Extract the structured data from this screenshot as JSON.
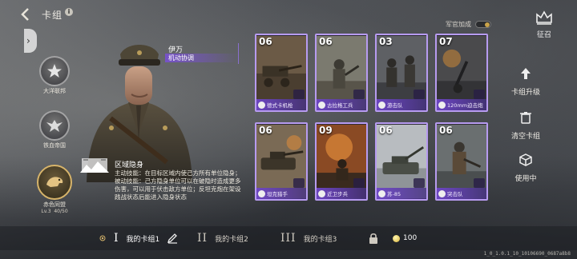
{
  "header": {
    "title": "卡组",
    "info_icon": "info-icon",
    "back_icon": "back-chevron-icon"
  },
  "bonus": {
    "label": "军官加成",
    "enabled": true
  },
  "recruit": {
    "label": "征召"
  },
  "factions": [
    {
      "name": "大洋联邦",
      "icon": "star-emblem-icon"
    },
    {
      "name": "铁血帝国",
      "icon": "eagle-emblem-icon"
    },
    {
      "name": "赤色同盟",
      "icon": "bear-emblem-icon",
      "active": true,
      "level": "Lv.3",
      "progress": "40/50"
    }
  ],
  "general": {
    "name": "伊万",
    "role": "机动协调",
    "skill_title": "区域隐身",
    "skill_active": "主动技能：在目标区域内使己方所有单位隐身；",
    "skill_passive": "被动技能：己方隐身单位可以在破隐时造成更多伤害，可以用于伏击敌方单位；反坦克炮在架设践战状态后能进入隐身状态"
  },
  "cards": [
    {
      "cost": "06",
      "name": "德式卡机枪"
    },
    {
      "cost": "06",
      "name": "古拉格工兵"
    },
    {
      "cost": "03",
      "name": "游击队"
    },
    {
      "cost": "07",
      "name": "120mm迫击炮"
    },
    {
      "cost": "06",
      "name": "坦克猎手"
    },
    {
      "cost": "09",
      "name": "近卫步兵"
    },
    {
      "cost": "06",
      "name": "苏-85"
    },
    {
      "cost": "06",
      "name": "突击队"
    }
  ],
  "actions": [
    {
      "label": "卡组升级",
      "icon": "upgrade-arrow-icon"
    },
    {
      "label": "清空卡组",
      "icon": "trash-icon"
    },
    {
      "label": "使用中",
      "icon": "cube-icon"
    }
  ],
  "decks": [
    {
      "roman": "I",
      "label": "我的卡组1",
      "active": true
    },
    {
      "roman": "II",
      "label": "我的卡组2"
    },
    {
      "roman": "III",
      "label": "我的卡组3"
    }
  ],
  "currency": {
    "value": "100"
  },
  "version": "1_0_1.0.1_10_10106690_0687a8b8",
  "colors": {
    "card_border": "#b79bf0",
    "card_banner": "#6e46c8",
    "accent_gold": "#d7b46a"
  }
}
